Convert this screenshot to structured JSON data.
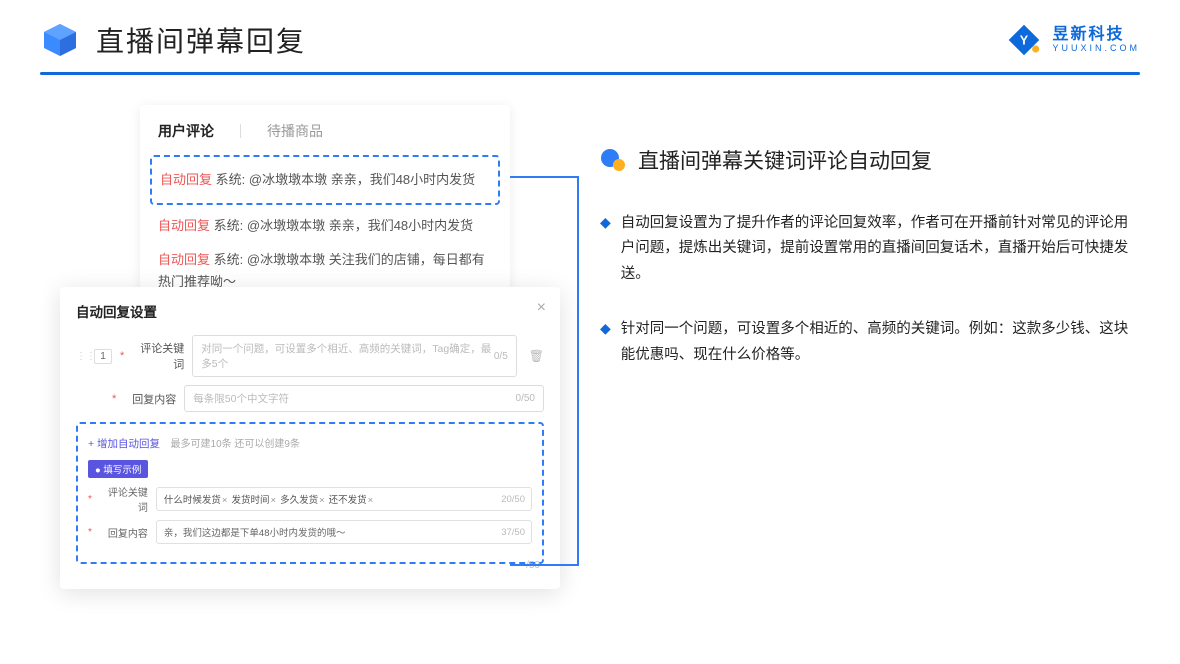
{
  "header": {
    "title": "直播间弹幕回复"
  },
  "brand": {
    "name": "昱新科技",
    "sub": "YUUXIN.COM"
  },
  "info": {
    "title": "直播间弹幕关键词评论自动回复",
    "bullets": [
      "自动回复设置为了提升作者的评论回复效率，作者可在开播前针对常见的评论用户问题，提炼出关键词，提前设置常用的直播间回复话术，直播开始后可快捷发送。",
      "针对同一个问题，可设置多个相近的、高频的关键词。例如：这款多少钱、这块能优惠吗、现在什么价格等。"
    ]
  },
  "comments": {
    "tabs": {
      "active": "用户评论",
      "inactive": "待播商品"
    },
    "badge": "自动回复",
    "sys": "系统:",
    "line1": "@冰墩墩本墩 亲亲，我们48小时内发货",
    "line2": "@冰墩墩本墩 亲亲，我们48小时内发货",
    "line3": "@冰墩墩本墩 关注我们的店铺，每日都有热门推荐呦～"
  },
  "settings": {
    "title": "自动回复设置",
    "num": "1",
    "kw_label": "评论关键词",
    "kw_placeholder": "对同一个问题，可设置多个相近、高频的关键词，Tag确定，最多5个",
    "kw_count": "0/5",
    "cont_label": "回复内容",
    "cont_placeholder": "每条限50个中文字符",
    "cont_count": "0/50",
    "add_link": "+ 增加自动回复",
    "add_hint": "最多可建10条 还可以创建9条",
    "example_badge": "● 填写示例",
    "ex_kw_label": "评论关键词",
    "ex_tags": [
      "什么时候发货",
      "发货时间",
      "多久发货",
      "还不发货"
    ],
    "ex_kw_count": "20/50",
    "ex_cont_label": "回复内容",
    "ex_cont_text": "亲，我们这边都是下单48小时内发货的哦～",
    "ex_cont_count": "37/50",
    "outer_count": "/50"
  }
}
